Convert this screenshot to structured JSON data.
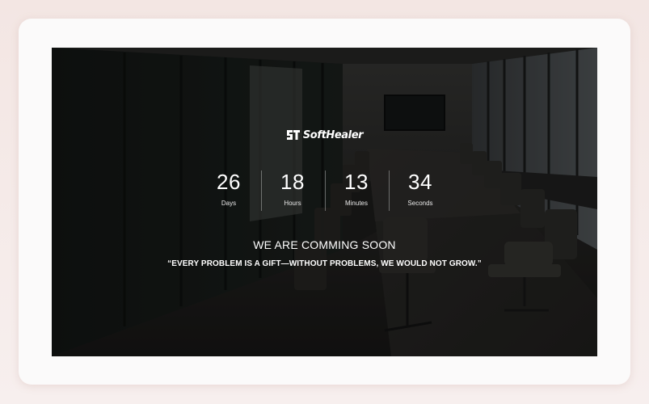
{
  "brand": {
    "logo_text": "SoftHealer"
  },
  "countdown": [
    {
      "value": "26",
      "label": "Days"
    },
    {
      "value": "18",
      "label": "Hours"
    },
    {
      "value": "13",
      "label": "Minutes"
    },
    {
      "value": "34",
      "label": "Seconds"
    }
  ],
  "headline": "WE ARE COMMING SOON",
  "quote": "“EVERY PROBLEM IS A GIFT—WITHOUT PROBLEMS, WE WOULD NOT GROW.”",
  "colors": {
    "page_bg": "#f6ecea",
    "card_bg": "#fbfafa",
    "text": "#ffffff"
  }
}
